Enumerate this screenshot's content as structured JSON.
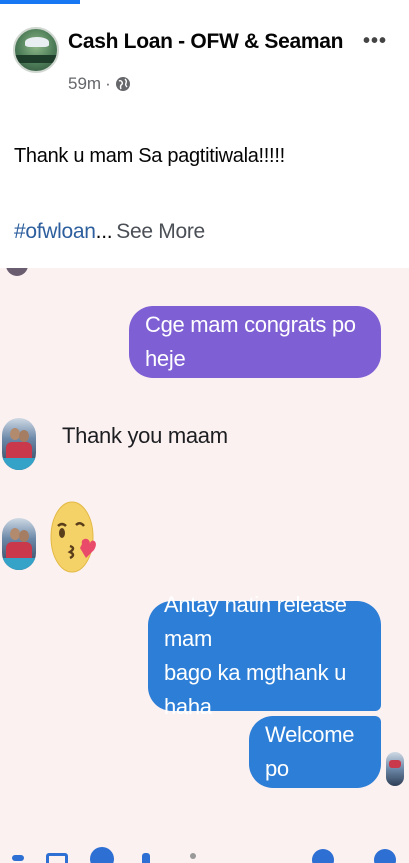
{
  "post": {
    "page_name": "Cash Loan - OFW & Seaman",
    "time": "59m",
    "separator": "·",
    "more_menu": "•••",
    "text": "Thank u mam Sa pagtitiwala!!!!!",
    "hashtag": "#ofwloan",
    "ellipsis": "...",
    "see_more": "See More"
  },
  "chat": {
    "messages": [
      {
        "side": "sent",
        "text": "Cge mam congrats po heje",
        "color": "#7e5fd4"
      },
      {
        "side": "received",
        "text": "Thank you maam"
      },
      {
        "side": "received",
        "type": "emoji",
        "icon": "kissing-face-heart-emoji"
      },
      {
        "side": "sent",
        "line1": "Antay natin release mam",
        "line2": "bago ka mgthank u haha",
        "color": "#2d7ed6"
      },
      {
        "side": "sent",
        "text": "Welcome po",
        "color": "#2d7ed6"
      }
    ]
  },
  "colors": {
    "accent": "#1877f2",
    "chat_background": "#fcf1f1",
    "hashtag": "#2d5f9e"
  }
}
